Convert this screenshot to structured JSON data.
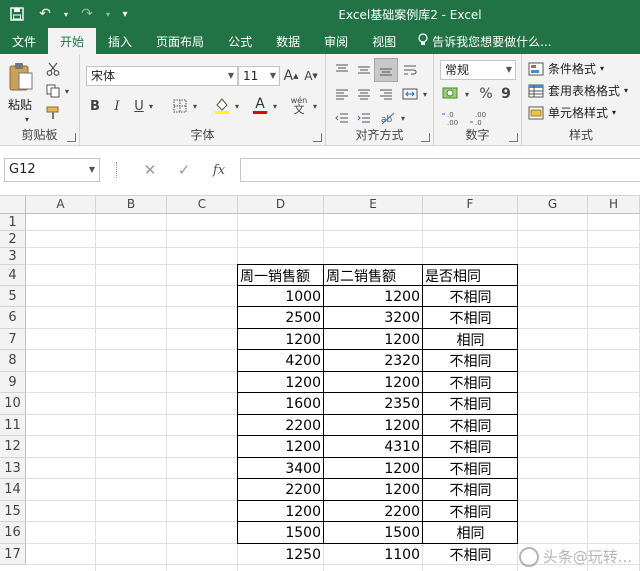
{
  "window": {
    "title": "Excel基础案例库2 - Excel"
  },
  "qat": {
    "save_icon": "save-icon",
    "undo_icon": "undo-icon",
    "redo_icon": "redo-icon",
    "customize": "▾"
  },
  "tabs": [
    {
      "label": "文件"
    },
    {
      "label": "开始"
    },
    {
      "label": "插入"
    },
    {
      "label": "页面布局"
    },
    {
      "label": "公式"
    },
    {
      "label": "数据"
    },
    {
      "label": "审阅"
    },
    {
      "label": "视图"
    }
  ],
  "tellme": {
    "label": "告诉我您想要做什么..."
  },
  "ribbon": {
    "clipboard": {
      "paste": "粘贴",
      "label": "剪贴板"
    },
    "font": {
      "name": "宋体",
      "size": "11",
      "grow": "A",
      "shrink": "A",
      "bold": "B",
      "italic": "I",
      "underline": "U",
      "pinyin": "wén",
      "label": "字体"
    },
    "align": {
      "label": "对齐方式"
    },
    "number": {
      "format": "常规",
      "percent": "%",
      "comma": "9",
      "label": "数字"
    },
    "styles": {
      "conditional": "条件格式",
      "table": "套用表格格式",
      "cell": "单元格样式",
      "label": "样式"
    }
  },
  "formula_bar": {
    "name_box": "G12",
    "cancel": "✕",
    "enter": "✓",
    "fx": "fx",
    "value": ""
  },
  "columns": [
    "A",
    "B",
    "C",
    "D",
    "E",
    "F",
    "G",
    "H"
  ],
  "rows": [
    "1",
    "2",
    "3",
    "4",
    "5",
    "6",
    "7",
    "8",
    "9",
    "10",
    "11",
    "12",
    "13",
    "14",
    "15",
    "16",
    "17"
  ],
  "table": {
    "headers": [
      "周一销售额",
      "周二销售额",
      "是否相同"
    ],
    "rows": [
      [
        "1000",
        "1200",
        "不相同"
      ],
      [
        "2500",
        "3200",
        "不相同"
      ],
      [
        "1200",
        "1200",
        "相同"
      ],
      [
        "4200",
        "2320",
        "不相同"
      ],
      [
        "1200",
        "1200",
        "不相同"
      ],
      [
        "1600",
        "2350",
        "不相同"
      ],
      [
        "2200",
        "1200",
        "不相同"
      ],
      [
        "1200",
        "4310",
        "不相同"
      ],
      [
        "3400",
        "1200",
        "不相同"
      ],
      [
        "2200",
        "1200",
        "不相同"
      ],
      [
        "1200",
        "2200",
        "不相同"
      ],
      [
        "1500",
        "1500",
        "相同"
      ],
      [
        "1250",
        "1100",
        "不相同"
      ]
    ]
  },
  "watermark": {
    "text": "头条@玩转..."
  }
}
